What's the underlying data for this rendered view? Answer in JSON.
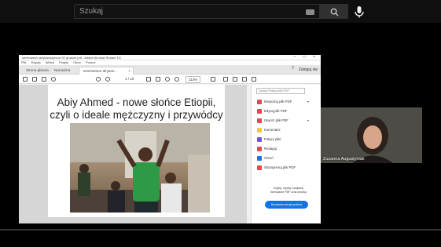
{
  "youtube": {
    "search_placeholder": "Szukaj",
    "icons": {
      "keyboard": "keyboard-icon",
      "search": "search-icon",
      "mic": "microphone-icon"
    }
  },
  "acrobat": {
    "window_title": "seminarium afrykanistyczne 01 grudzie.pdf - Adobe Acrobat Reader DC",
    "menu": [
      "Plik",
      "Edycja",
      "Widok",
      "Podpis",
      "Okno",
      "Pomoc"
    ],
    "tabs": [
      {
        "label": "Strona główna",
        "active": false
      },
      {
        "label": "Narzędzia",
        "active": false
      },
      {
        "label": "seminarium afrykan...",
        "active": true,
        "close": "×"
      }
    ],
    "help": "?",
    "login_label": "Zaloguj się",
    "page_info": "1 / 10",
    "zoom": "113%",
    "slide": {
      "title_line1": "Abiy Ahmed - nowe słońce Etiopii,",
      "title_line2": "czyli o ideale mężczyzny i przywódcy"
    },
    "tools_search_placeholder": "Szukaj 'Połącz pliki PDF'",
    "tools": [
      {
        "label": "Eksportuj plik PDF",
        "color": "#e34850",
        "arrow": "▾"
      },
      {
        "label": "Edytuj plik PDF",
        "color": "#e34850",
        "arrow": ""
      },
      {
        "label": "Utwórz plik PDF",
        "color": "#e34850",
        "arrow": "▾"
      },
      {
        "label": "Komentarz",
        "color": "#f5c542",
        "arrow": ""
      },
      {
        "label": "Połącz pliki",
        "color": "#7b4fd6",
        "arrow": ""
      },
      {
        "label": "Redaguj",
        "color": "#e34850",
        "arrow": ""
      },
      {
        "label": "Chroń",
        "color": "#1473e6",
        "arrow": ""
      },
      {
        "label": "Skompresuj plik PDF",
        "color": "#e34850",
        "arrow": ""
      }
    ],
    "promo_text_line1": "Edytuj, edytuj i podpisuj",
    "promo_text_line2": "formularze PDF oraz umowy",
    "promo_button": "Bezpłatna wersja próbna"
  },
  "presenter": {
    "name": "Zuzanna Augustyniak"
  },
  "video_progress": 0
}
